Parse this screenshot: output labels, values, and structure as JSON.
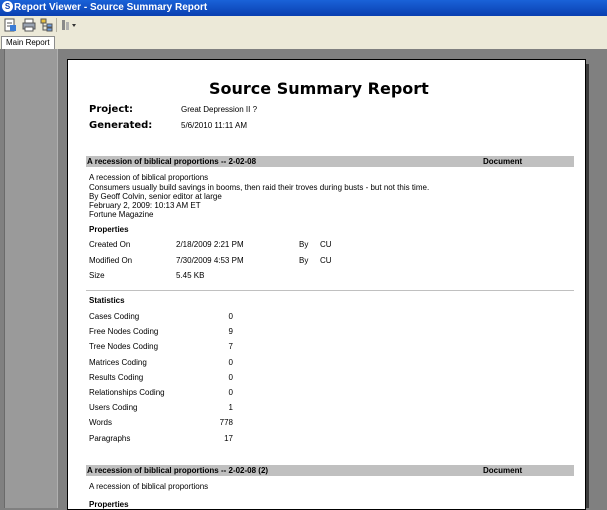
{
  "window": {
    "title": "Report Viewer - Source Summary Report"
  },
  "toolbar": {
    "icons": [
      "export-icon",
      "print-icon",
      "tree-icon",
      "zoom-icon"
    ]
  },
  "tabs": [
    {
      "label": "Main Report"
    }
  ],
  "report": {
    "title": "Source Summary Report",
    "project_label": "Project:",
    "project_value": "Great Depression II ?",
    "generated_label": "Generated:",
    "generated_value": "5/6/2010 11:11 AM",
    "sections": [
      {
        "header": "A recession of biblical proportions -- 2-02-08",
        "type": "Document",
        "lines": [
          "A recession of biblical proportions",
          "Consumers usually build savings in booms, then raid their troves during busts - but not this time.",
          "By Geoff Colvin, senior editor at large",
          "February 2, 2009: 10:13 AM ET",
          "Fortune Magazine"
        ],
        "properties_label": "Properties",
        "properties": [
          {
            "name": "Created On",
            "value": "2/18/2009 2:21 PM",
            "by_label": "By",
            "by": "CU"
          },
          {
            "name": "Modified On",
            "value": "7/30/2009 4:53 PM",
            "by_label": "By",
            "by": "CU"
          },
          {
            "name": "Size",
            "value": "5.45 KB"
          }
        ],
        "statistics_label": "Statistics",
        "statistics": [
          {
            "name": "Cases Coding",
            "value": "0"
          },
          {
            "name": "Free Nodes Coding",
            "value": "9"
          },
          {
            "name": "Tree Nodes Coding",
            "value": "7"
          },
          {
            "name": "Matrices Coding",
            "value": "0"
          },
          {
            "name": "Results Coding",
            "value": "0"
          },
          {
            "name": "Relationships Coding",
            "value": "0"
          },
          {
            "name": "Users Coding",
            "value": "1"
          },
          {
            "name": "Words",
            "value": "778"
          },
          {
            "name": "Paragraphs",
            "value": "17"
          }
        ]
      },
      {
        "header": "A recession of biblical proportions -- 2-02-08 (2)",
        "type": "Document",
        "lines": [
          "A recession of biblical proportions"
        ],
        "properties_label": "Properties"
      }
    ]
  }
}
